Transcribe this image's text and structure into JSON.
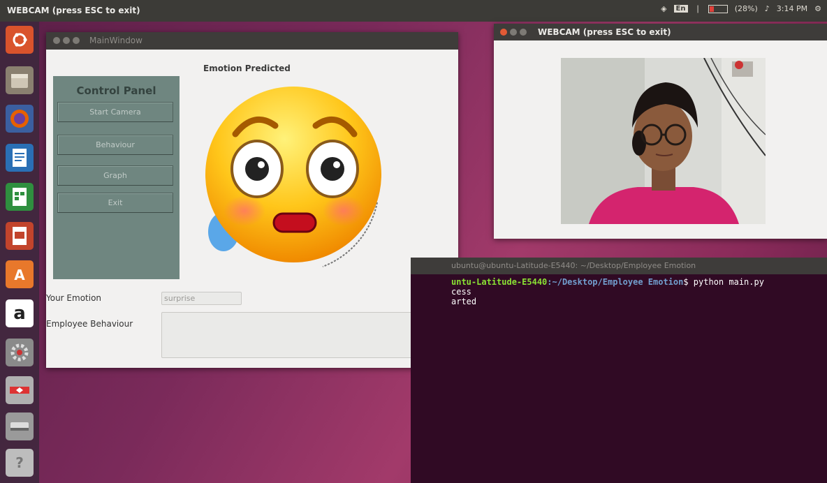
{
  "top_panel": {
    "title": "WEBCAM (press ESC to exit)",
    "keyboard_layout": "En",
    "battery": "(28%)",
    "time": "3:14 PM"
  },
  "launcher": {
    "items": [
      {
        "icon": "ubuntu-dash-icon",
        "color": "#d9532c"
      },
      {
        "icon": "files-icon",
        "color": "#8a8070"
      },
      {
        "icon": "firefox-icon",
        "color": "#e66000"
      },
      {
        "icon": "writer-icon",
        "color": "#2a6fb5"
      },
      {
        "icon": "calc-icon",
        "color": "#2f8f3f"
      },
      {
        "icon": "impress-icon",
        "color": "#c2442c"
      },
      {
        "icon": "software-center-icon",
        "color": "#e8782b"
      },
      {
        "icon": "amazon-icon",
        "color": "#ffffff",
        "text": "a"
      },
      {
        "icon": "settings-icon",
        "color": "#9a9a9a"
      },
      {
        "icon": "app-icon",
        "color": "#c04040"
      },
      {
        "icon": "drive-icon",
        "color": "#aaaaaa"
      },
      {
        "icon": "help-icon",
        "color": "#cccccc",
        "text": "?"
      }
    ]
  },
  "main_window": {
    "title": "MainWindow",
    "control_panel": {
      "title": "Control Panel",
      "buttons": [
        "Start Camera",
        "Behaviour",
        "Graph",
        "Exit"
      ]
    },
    "emotion_label": "Emotion Predicted",
    "your_emotion_label": "Your Emotion",
    "your_emotion_value": "surprise",
    "behaviour_label": "Employee Behaviour",
    "behaviour_value": ""
  },
  "webcam_window": {
    "title": "WEBCAM (press ESC to exit)"
  },
  "terminal": {
    "title": "ubuntu@ubuntu-Latitude-E5440: ~/Desktop/Employee Emotion",
    "prompt_user": "untu-Latitude-E5440",
    "prompt_path": ":~/Desktop/Employee Emotion",
    "prompt_cmd": "$ python main.py",
    "lines": [
      "cess",
      "arted"
    ]
  }
}
